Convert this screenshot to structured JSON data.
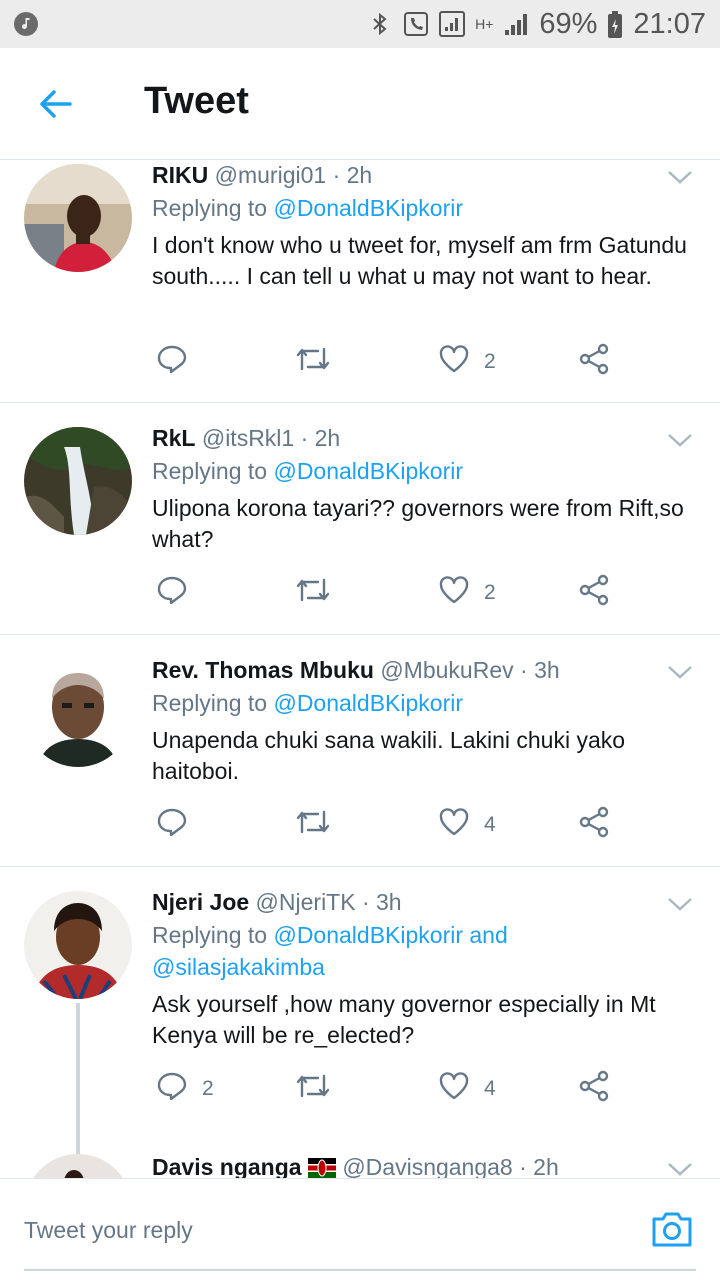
{
  "status_bar": {
    "battery": "69%",
    "time": "21:07",
    "network": "H+"
  },
  "header": {
    "title": "Tweet"
  },
  "tweets": [
    {
      "name": "RIKU",
      "handle": "@murigi01",
      "time": "· 2h",
      "replying_label": "Replying to",
      "replying_to": "@DonaldBKipkorir",
      "text": "I don't know who u tweet for, myself am frm Gatundu south..... I can tell u what u may not want to hear.",
      "likes": "2"
    },
    {
      "name": "RkL",
      "handle": "@itsRkl1",
      "time": "· 2h",
      "replying_label": "Replying to",
      "replying_to": "@DonaldBKipkorir",
      "text": "Ulipona korona tayari?? governors were from Rift,so what?",
      "likes": "2"
    },
    {
      "name": "Rev. Thomas Mbuku",
      "handle": "@MbukuRev",
      "time": "· 3h",
      "replying_label": "Replying to",
      "replying_to": "@DonaldBKipkorir",
      "text": "Unapenda chuki sana wakili. Lakini chuki yako haitoboi.",
      "likes": "4"
    },
    {
      "name": "Njeri Joe",
      "handle": "@NjeriTK",
      "time": "· 3h",
      "replying_label": "Replying to",
      "replying_to": "@DonaldBKipkorir and",
      "replying_to_2": "@silasjakakimba",
      "text": "Ask yourself ,how many governor especially in Mt Kenya will be re_elected?",
      "replies": "2",
      "likes": "4"
    },
    {
      "name": "Davis nganga",
      "handle": "@Davisnganga8",
      "time": "· 2h"
    }
  ],
  "reply_bar": {
    "placeholder": "Tweet your reply"
  },
  "colors": {
    "accent": "#1da1f2",
    "muted": "#657786",
    "divider": "#e1e8ed"
  }
}
